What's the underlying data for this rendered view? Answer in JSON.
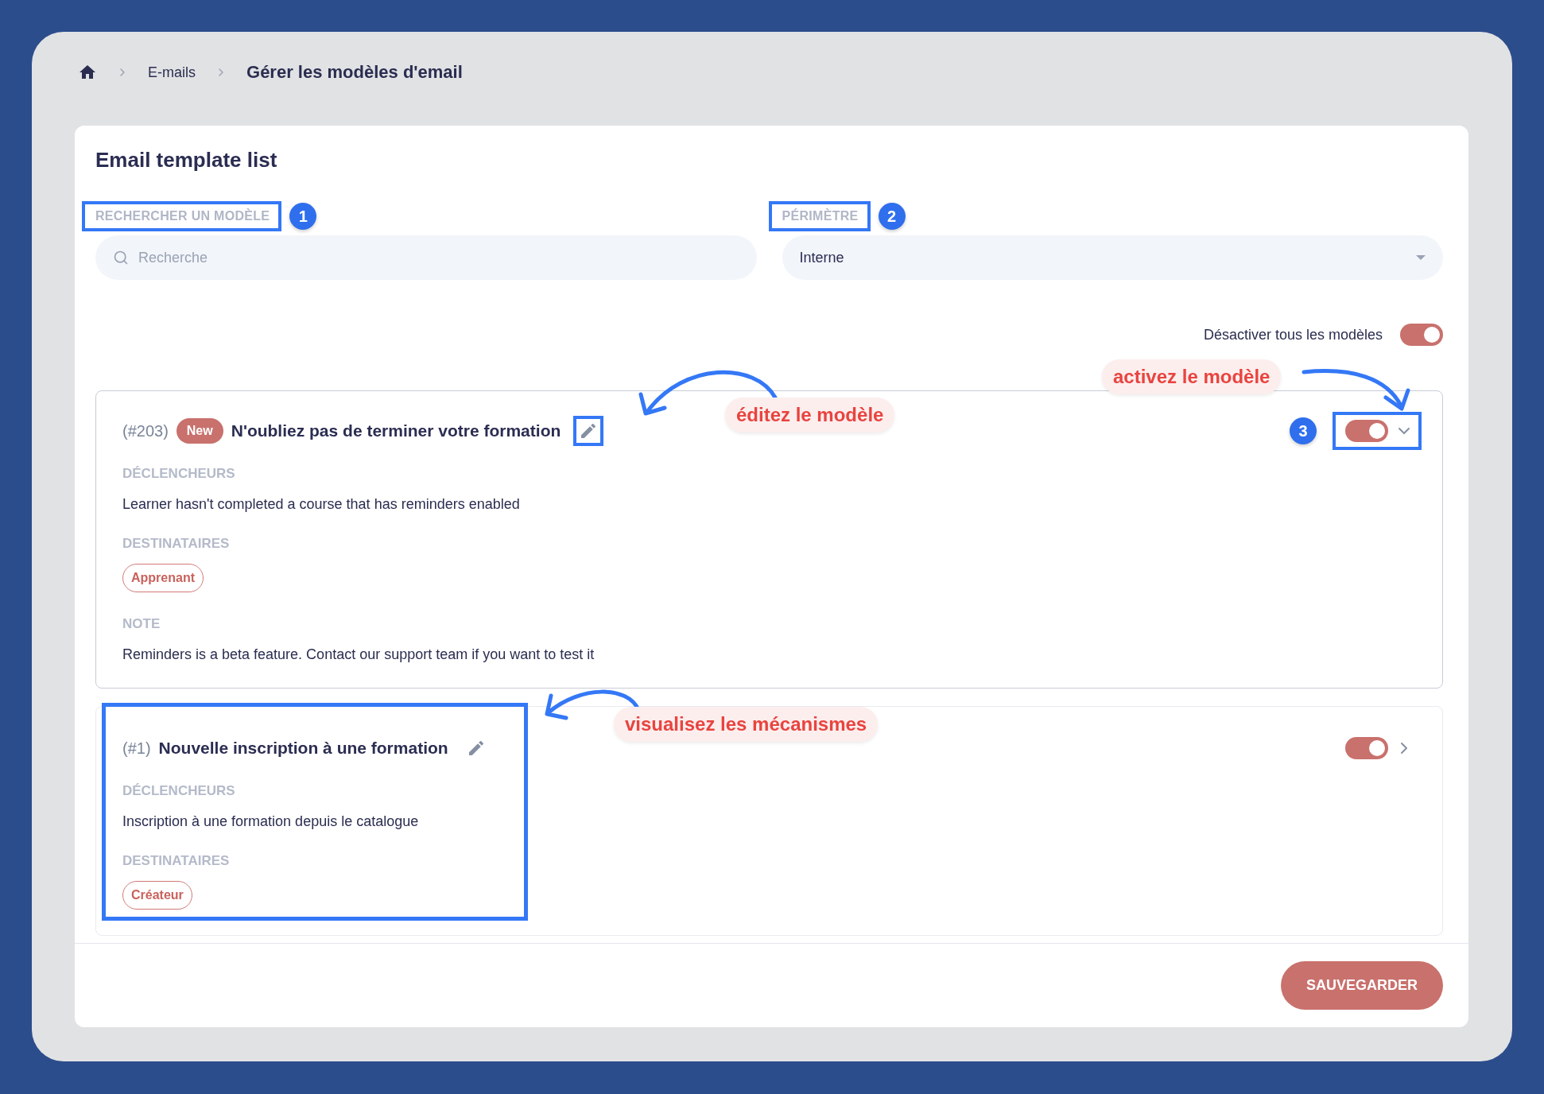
{
  "breadcrumb": [
    {
      "label": "E-mails",
      "current": false
    },
    {
      "label": "Gérer les modèles d'email",
      "current": true
    }
  ],
  "panel": {
    "title": "Email template list"
  },
  "filters": [
    {
      "kind": "search",
      "label": "RECHERCHER UN MODÈLE",
      "placeholder": "Recherche",
      "marker": "1",
      "highlight": true
    },
    {
      "kind": "select",
      "label": "PÉRIMÈTRE",
      "value": "Interne",
      "marker": "2",
      "highlight": true
    }
  ],
  "bulk_toggle": {
    "label": "Désactiver tous les modèles",
    "on": true
  },
  "templates": [
    {
      "number": "(#203)",
      "badge": "New",
      "title": "N'oubliez pas de terminer votre formation",
      "on": true,
      "expanded": true,
      "marker": "3",
      "edit_highlighted": true,
      "toggle_highlighted": true,
      "content_highlighted": false,
      "sections": [
        {
          "kind": "text",
          "heading": "DÉCLENCHEURS",
          "text": "Learner hasn't completed a course that has reminders enabled"
        },
        {
          "kind": "tags",
          "heading": "DESTINATAIRES",
          "tags": [
            "Apprenant"
          ]
        },
        {
          "kind": "text",
          "heading": "NOTE",
          "text": "Reminders is a beta feature. Contact our support team if you want to test it"
        }
      ]
    },
    {
      "number": "(#1)",
      "title": "Nouvelle inscription à une formation",
      "on": true,
      "expanded": false,
      "edit_highlighted": false,
      "toggle_highlighted": false,
      "content_highlighted": true,
      "sections": [
        {
          "kind": "text",
          "heading": "DÉCLENCHEURS",
          "text": "Inscription à une formation depuis le catalogue"
        },
        {
          "kind": "tags",
          "heading": "DESTINATAIRES",
          "tags": [
            "Créateur"
          ]
        }
      ]
    }
  ],
  "save_button": "SAUVEGARDER",
  "callouts": [
    "éditez le modèle",
    "activez le modèle",
    "visualisez les mécanismes"
  ]
}
